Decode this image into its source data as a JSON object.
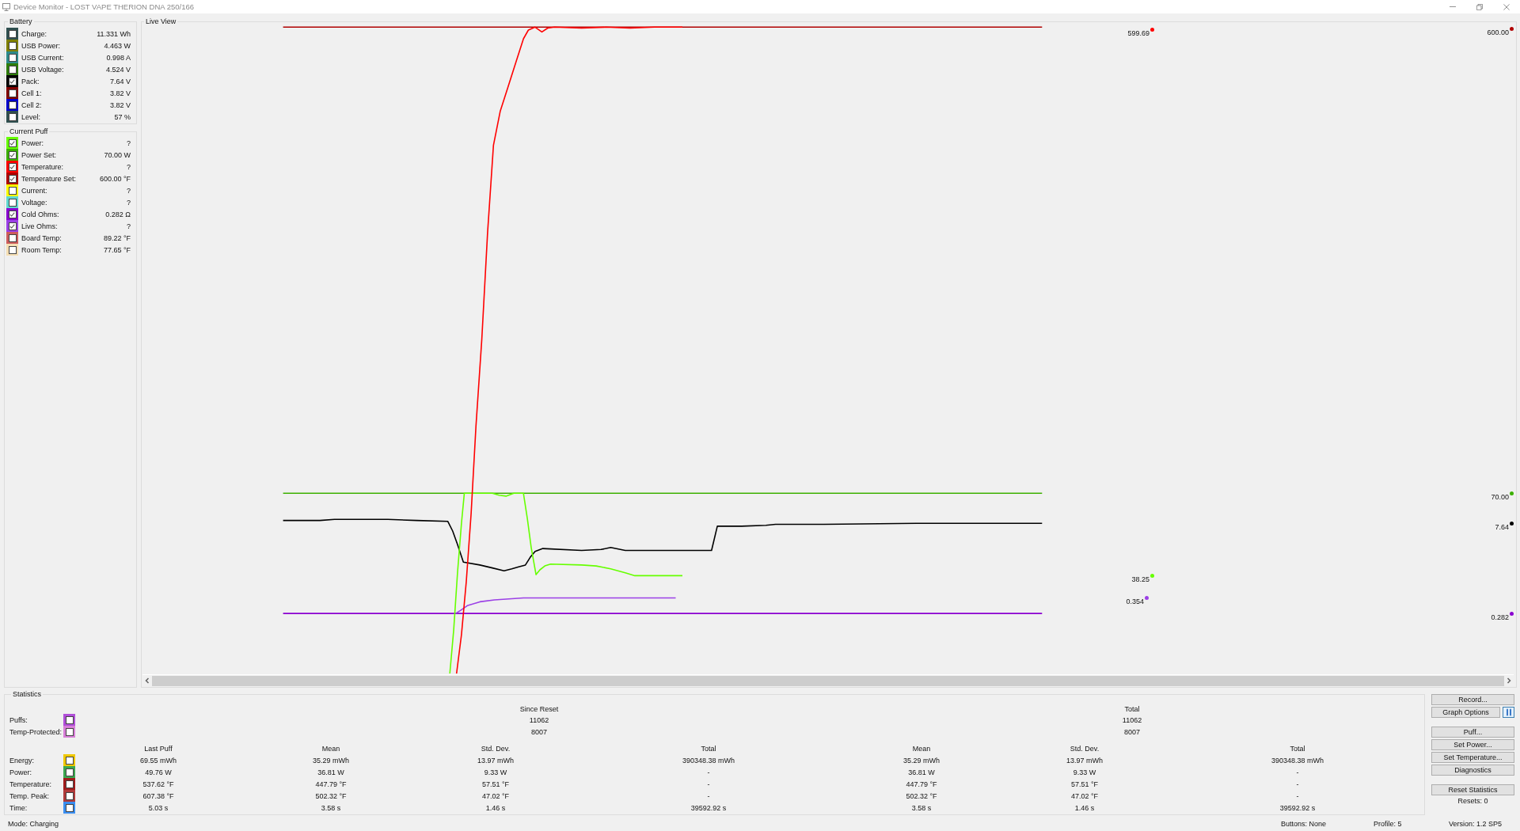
{
  "window": {
    "title": "Device Monitor - LOST VAPE THERION DNA 250/166"
  },
  "battery": {
    "title": "Battery",
    "items": [
      {
        "label": "Charge:",
        "value": "11.331 Wh",
        "color": "#2f4f4f",
        "checked": false
      },
      {
        "label": "USB Power:",
        "value": "4.463 W",
        "color": "#808000",
        "checked": false
      },
      {
        "label": "USB Current:",
        "value": "0.998 A",
        "color": "#2e8b8b",
        "checked": false
      },
      {
        "label": "USB Voltage:",
        "value": "4.524 V",
        "color": "#2e7d0a",
        "checked": false
      },
      {
        "label": "Pack:",
        "value": "7.64 V",
        "color": "#000000",
        "checked": true
      },
      {
        "label": "Cell 1:",
        "value": "3.82 V",
        "color": "#800000",
        "checked": false
      },
      {
        "label": "Cell 2:",
        "value": "3.82 V",
        "color": "#0000cd",
        "checked": false
      },
      {
        "label": "Level:",
        "value": "57 %",
        "color": "#2f4f4f",
        "checked": false
      }
    ]
  },
  "current_puff": {
    "title": "Current Puff",
    "items": [
      {
        "label": "Power:",
        "value": "?",
        "color": "#66ff00",
        "checked": true
      },
      {
        "label": "Power Set:",
        "value": "70.00 W",
        "color": "#3cb000",
        "checked": true
      },
      {
        "label": "Temperature:",
        "value": "?",
        "color": "#ff0000",
        "checked": true
      },
      {
        "label": "Temperature Set:",
        "value": "600.00 °F",
        "color": "#b00000",
        "checked": true
      },
      {
        "label": "Current:",
        "value": "?",
        "color": "#ffff00",
        "checked": false
      },
      {
        "label": "Voltage:",
        "value": "?",
        "color": "#60d8d0",
        "checked": false
      },
      {
        "label": "Cold Ohms:",
        "value": "0.282 Ω",
        "color": "#8a00d0",
        "checked": true
      },
      {
        "label": "Live Ohms:",
        "value": "?",
        "color": "#9b40e6",
        "checked": true
      },
      {
        "label": "Board Temp:",
        "value": "89.22 °F",
        "color": "#cd5c5c",
        "checked": false
      },
      {
        "label": "Room Temp:",
        "value": "77.65 °F",
        "color": "#f5deb3",
        "checked": false
      }
    ]
  },
  "live_view": {
    "title": "Live View",
    "markers": [
      {
        "value": "599.69",
        "color": "#ff0000"
      },
      {
        "value": "600.00",
        "color": "#b00000"
      },
      {
        "value": "70.00",
        "color": "#3cb000"
      },
      {
        "value": "7.64",
        "color": "#000000"
      },
      {
        "value": "38.25",
        "color": "#66ff00"
      },
      {
        "value": "0.354",
        "color": "#9b40e6"
      },
      {
        "value": "0.282",
        "color": "#8a00d0"
      }
    ]
  },
  "statistics": {
    "title": "Statistics",
    "since_reset_heading": "Since Reset",
    "total_heading": "Total",
    "counters": [
      {
        "label": "Puffs:",
        "color": "#b04fd8",
        "checked": false,
        "since_reset": "11062",
        "total": "11062"
      },
      {
        "label": "Temp-Protected:",
        "color": "#d77fd7",
        "checked": false,
        "since_reset": "8007",
        "total": "8007"
      }
    ],
    "columns": [
      "Last Puff",
      "Mean",
      "Std. Dev.",
      "Total",
      "Mean",
      "Std. Dev.",
      "Total"
    ],
    "rows": [
      {
        "label": "Energy:",
        "color": "#f0c800",
        "checked": false,
        "cells": [
          "69.55 mWh",
          "35.29 mWh",
          "13.97 mWh",
          "390348.38 mWh",
          "35.29 mWh",
          "13.97 mWh",
          "390348.38 mWh"
        ]
      },
      {
        "label": "Power:",
        "color": "#3ca850",
        "checked": false,
        "cells": [
          "49.76 W",
          "36.81 W",
          "9.33 W",
          "-",
          "36.81 W",
          "9.33 W",
          "-"
        ]
      },
      {
        "label": "Temperature:",
        "color": "#a01c1c",
        "checked": false,
        "cells": [
          "537.62 °F",
          "447.79 °F",
          "57.51 °F",
          "-",
          "447.79 °F",
          "57.51 °F",
          "-"
        ]
      },
      {
        "label": "Temp. Peak:",
        "color": "#b03a3a",
        "checked": false,
        "cells": [
          "607.38 °F",
          "502.32 °F",
          "47.02 °F",
          "-",
          "502.32 °F",
          "47.02 °F",
          "-"
        ]
      },
      {
        "label": "Time:",
        "color": "#3a8ef0",
        "checked": false,
        "cells": [
          "5.03 s",
          "3.58 s",
          "1.46 s",
          "39592.92 s",
          "3.58 s",
          "1.46 s",
          "39592.92 s"
        ]
      }
    ]
  },
  "actions": {
    "groups": [
      {
        "buttons": [
          {
            "label": "Record...",
            "kind": "plain"
          },
          {
            "label": "Graph Options",
            "kind": "with-pause"
          }
        ]
      },
      {
        "buttons": [
          {
            "label": "Puff...",
            "kind": "plain"
          },
          {
            "label": "Set Power...",
            "kind": "plain"
          },
          {
            "label": "Set Temperature...",
            "kind": "plain"
          },
          {
            "label": "Diagnostics",
            "kind": "plain"
          }
        ]
      },
      {
        "buttons": [
          {
            "label": "Reset Statistics",
            "kind": "plain"
          }
        ]
      }
    ],
    "resets": "Resets: 0"
  },
  "status_bar": {
    "mode": "Mode: Charging",
    "buttons": "Buttons: None",
    "profile": "Profile: 5",
    "version": "Version: 1.2 SP5"
  }
}
